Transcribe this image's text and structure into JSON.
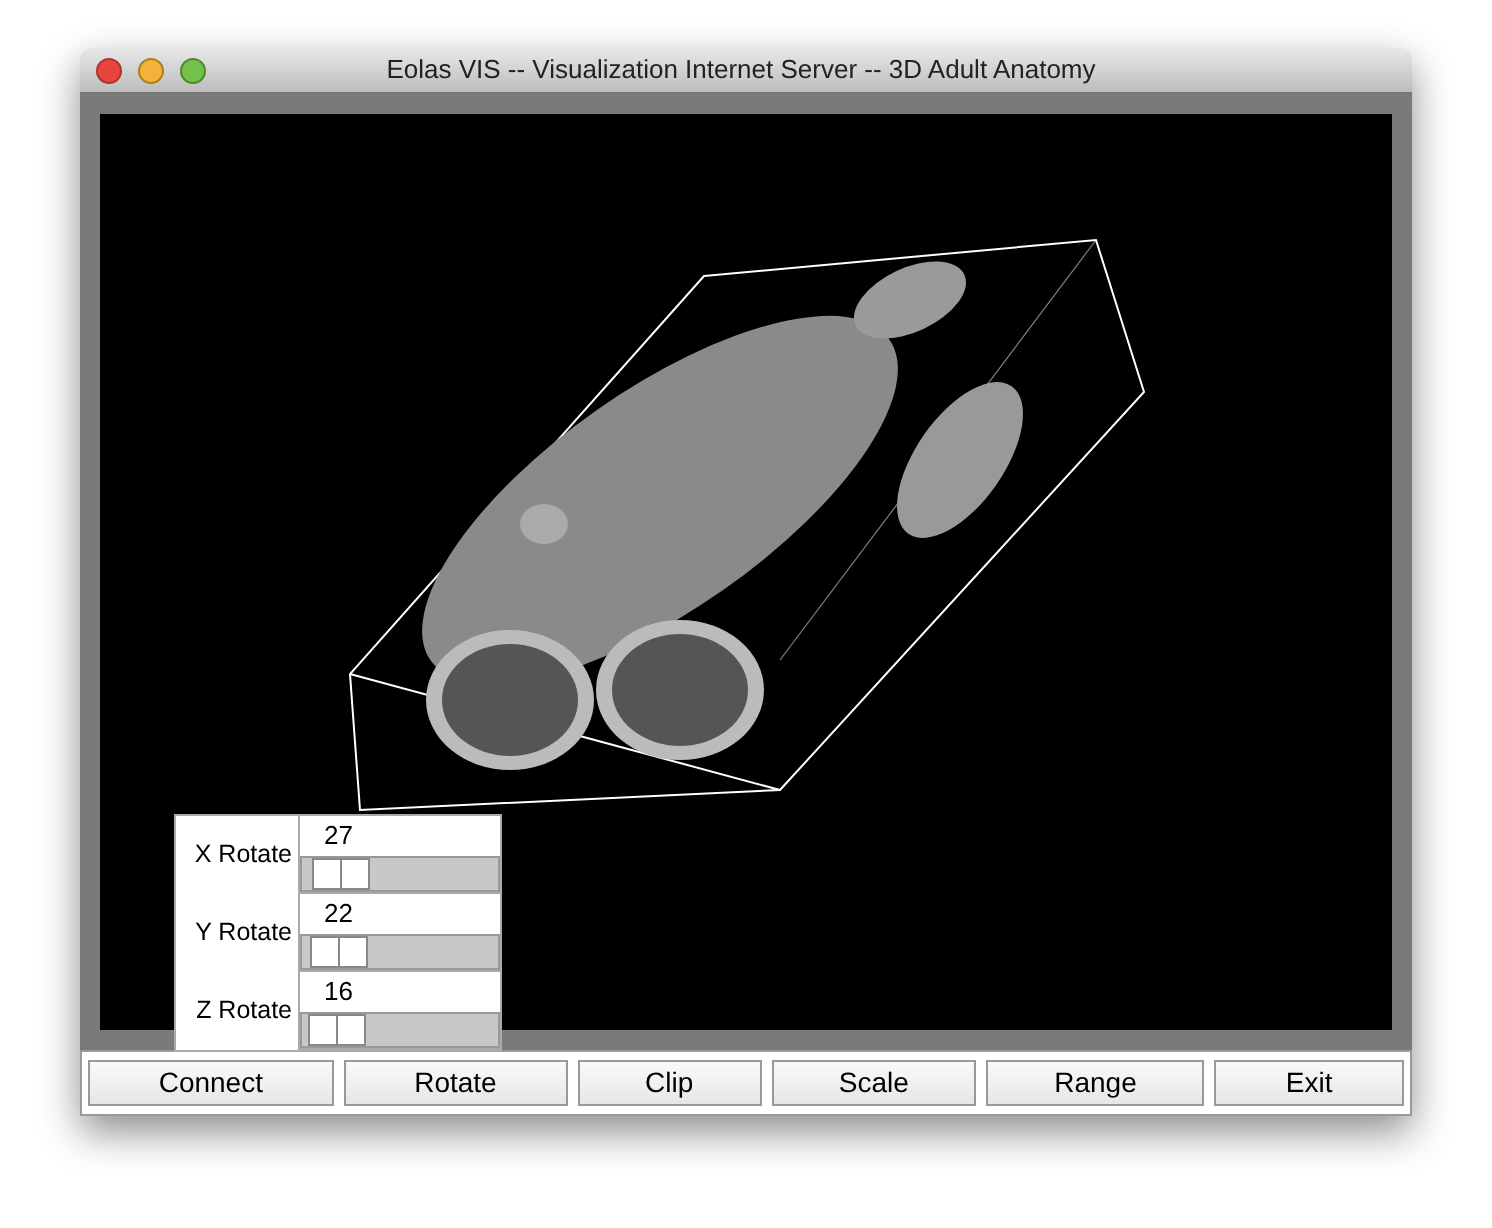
{
  "window": {
    "title": "Eolas VIS -- Visualization Internet Server -- 3D Adult Anatomy"
  },
  "rotations": [
    {
      "label": "X Rotate",
      "value": "27",
      "level": 0.075
    },
    {
      "label": "Y Rotate",
      "value": "22",
      "level": 0.061
    },
    {
      "label": "Z Rotate",
      "value": "16",
      "level": 0.044
    }
  ],
  "buttons": [
    "Connect",
    "Rotate",
    "Clip",
    "Scale",
    "Range",
    "Exit"
  ]
}
